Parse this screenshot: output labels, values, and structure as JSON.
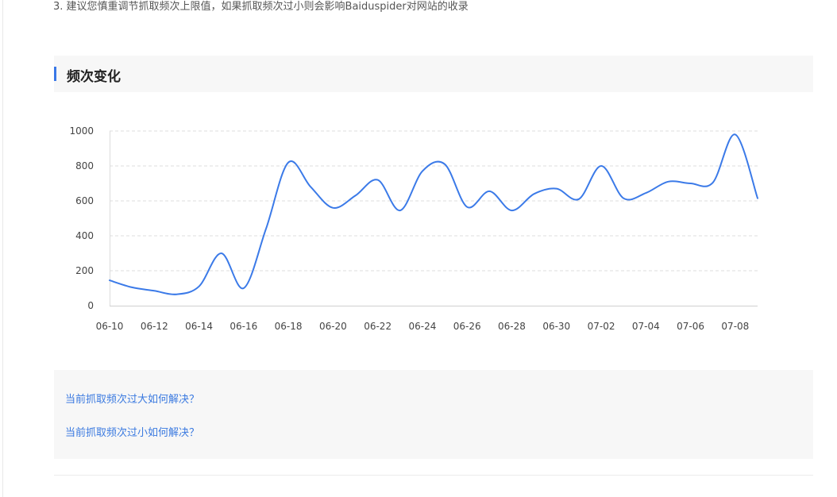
{
  "note": "3. 建议您慎重调节抓取频次上限值，如果抓取频次过小则会影响Baiduspider对网站的收录",
  "section": {
    "title": "频次变化"
  },
  "faq": [
    {
      "label": "当前抓取频次过大如何解决？"
    },
    {
      "label": "当前抓取频次过小如何解决？"
    }
  ],
  "colors": {
    "line": "#3b7ae8",
    "accent": "#3a78e7",
    "link": "#3b7ae0"
  },
  "chart_data": {
    "type": "line",
    "title": "",
    "xlabel": "",
    "ylabel": "",
    "ylim": [
      0,
      1000
    ],
    "yticks": [
      "0",
      "200",
      "400",
      "600",
      "800",
      "1000"
    ],
    "grid": "horizontal-dashed",
    "x": [
      "06-10",
      "06-11",
      "06-12",
      "06-13",
      "06-14",
      "06-15",
      "06-16",
      "06-17",
      "06-18",
      "06-19",
      "06-20",
      "06-21",
      "06-22",
      "06-23",
      "06-24",
      "06-25",
      "06-26",
      "06-27",
      "06-28",
      "06-29",
      "06-30",
      "07-01",
      "07-02",
      "07-03",
      "07-04",
      "07-05",
      "07-06",
      "07-07",
      "07-08",
      "07-09"
    ],
    "xticks": [
      "06-10",
      "06-12",
      "06-14",
      "06-16",
      "06-18",
      "06-20",
      "06-22",
      "06-24",
      "06-26",
      "06-28",
      "06-30",
      "07-02",
      "07-04",
      "07-06",
      "07-08"
    ],
    "series": [
      {
        "values": [
          145,
          105,
          85,
          65,
          110,
          300,
          100,
          440,
          820,
          680,
          560,
          630,
          720,
          545,
          770,
          810,
          565,
          655,
          545,
          640,
          670,
          610,
          800,
          615,
          645,
          710,
          700,
          705,
          980,
          615
        ]
      }
    ]
  }
}
